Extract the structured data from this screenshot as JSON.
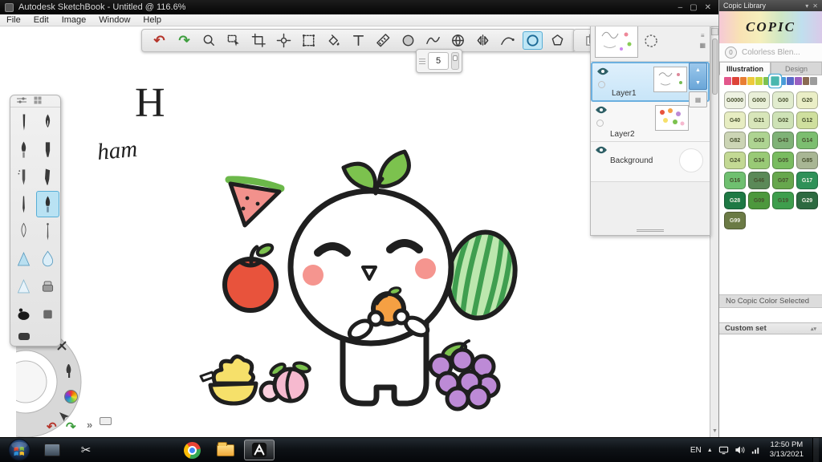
{
  "window": {
    "title": "Autodesk SketchBook - Untitled @ 116.6%",
    "controls": [
      "minimize",
      "restore",
      "close"
    ]
  },
  "menu": {
    "items": [
      "File",
      "Edit",
      "Image",
      "Window",
      "Help"
    ]
  },
  "toolbar": {
    "icon_names": [
      "undo",
      "redo",
      "zoom",
      "select",
      "crop",
      "transform",
      "distort",
      "fill",
      "text",
      "ruler",
      "disc",
      "french-curve",
      "perspective",
      "symmetry",
      "stroke",
      "circle",
      "polygon"
    ],
    "selected": "circle"
  },
  "panel_toggles": {
    "icon_names": [
      "copy",
      "brush-library",
      "color-wheel",
      "swatches"
    ]
  },
  "brush_popup": {
    "size": "5"
  },
  "brush_panel": {
    "brush_names": [
      "pencil",
      "ink-pen",
      "paintbrush",
      "marker",
      "airbrush",
      "chisel-marker",
      "technical-pen",
      "round-brush",
      "nib-pen",
      "fine-liner",
      "smudge",
      "water-drop",
      "soft-airbrush",
      "eraser-hard",
      "ink-blob",
      "eraser-pad"
    ],
    "selected": "round-brush",
    "footer_icon": "eraser"
  },
  "layers_panel": {
    "layers": [
      {
        "name": "Layer1",
        "selected": true
      },
      {
        "name": "Layer2",
        "selected": false
      },
      {
        "name": "Background",
        "selected": false
      }
    ]
  },
  "copic": {
    "title": "Copic Library",
    "logo_text": "COPIC",
    "blender": {
      "badge": "0",
      "label": "Colorless Blen..."
    },
    "tabs": [
      {
        "label": "Illustration",
        "active": true
      },
      {
        "label": "Design",
        "active": false
      }
    ],
    "rainbow": [
      "#e2578b",
      "#dd4338",
      "#e87e33",
      "#eec93b",
      "#c8d83e",
      "#7ec24f",
      "#49b7ae",
      "#4a9ad8",
      "#5a6ac8",
      "#9a5fc0",
      "#8a6a52",
      "#9c9c9c"
    ],
    "rainbow_selected": 6,
    "swatches": [
      {
        "code": "G0000",
        "color": "#eef2e2"
      },
      {
        "code": "G000",
        "color": "#e9efd8"
      },
      {
        "code": "G00",
        "color": "#e1ecce"
      },
      {
        "code": "G20",
        "color": "#eaeec6"
      },
      {
        "code": "G40",
        "color": "#e7edc2"
      },
      {
        "code": "G21",
        "color": "#d8e6ba"
      },
      {
        "code": "G02",
        "color": "#cee2b6"
      },
      {
        "code": "G12",
        "color": "#cfdf9e"
      },
      {
        "code": "G82",
        "color": "#ccd5b5"
      },
      {
        "code": "G03",
        "color": "#aed492"
      },
      {
        "code": "G43",
        "color": "#7fb277"
      },
      {
        "code": "G14",
        "color": "#7cbe70"
      },
      {
        "code": "G24",
        "color": "#c3d994"
      },
      {
        "code": "G34",
        "color": "#99ca76"
      },
      {
        "code": "G05",
        "color": "#79bc60"
      },
      {
        "code": "G85",
        "color": "#a8b694"
      },
      {
        "code": "G16",
        "color": "#6fc070"
      },
      {
        "code": "G46",
        "color": "#5b8958"
      },
      {
        "code": "G07",
        "color": "#67a74d"
      },
      {
        "code": "G17",
        "color": "#2f9158"
      },
      {
        "code": "G28",
        "color": "#1e7944"
      },
      {
        "code": "G09",
        "color": "#4d983d"
      },
      {
        "code": "G19",
        "color": "#3e9e4d"
      },
      {
        "code": "G29",
        "color": "#2d6a41"
      },
      {
        "code": "G99",
        "color": "#6b7a45"
      }
    ],
    "no_color_text": "No Copic Color Selected",
    "custom_set_label": "Custom set"
  },
  "canvas": {
    "texts": {
      "h": "H",
      "ham": "ham"
    }
  },
  "lagoon": {
    "icon_names": [
      "transform",
      "brush",
      "color-wheel",
      "cursor",
      "undo",
      "redo",
      "more",
      "keyboard"
    ]
  },
  "taskbar": {
    "apps": [
      "app",
      "snipping-tool",
      "chrome",
      "explorer",
      "sketchbook"
    ],
    "active_app": "sketchbook",
    "tray": {
      "lang": "EN",
      "time": "12:50 PM",
      "date": "3/13/2021"
    }
  }
}
